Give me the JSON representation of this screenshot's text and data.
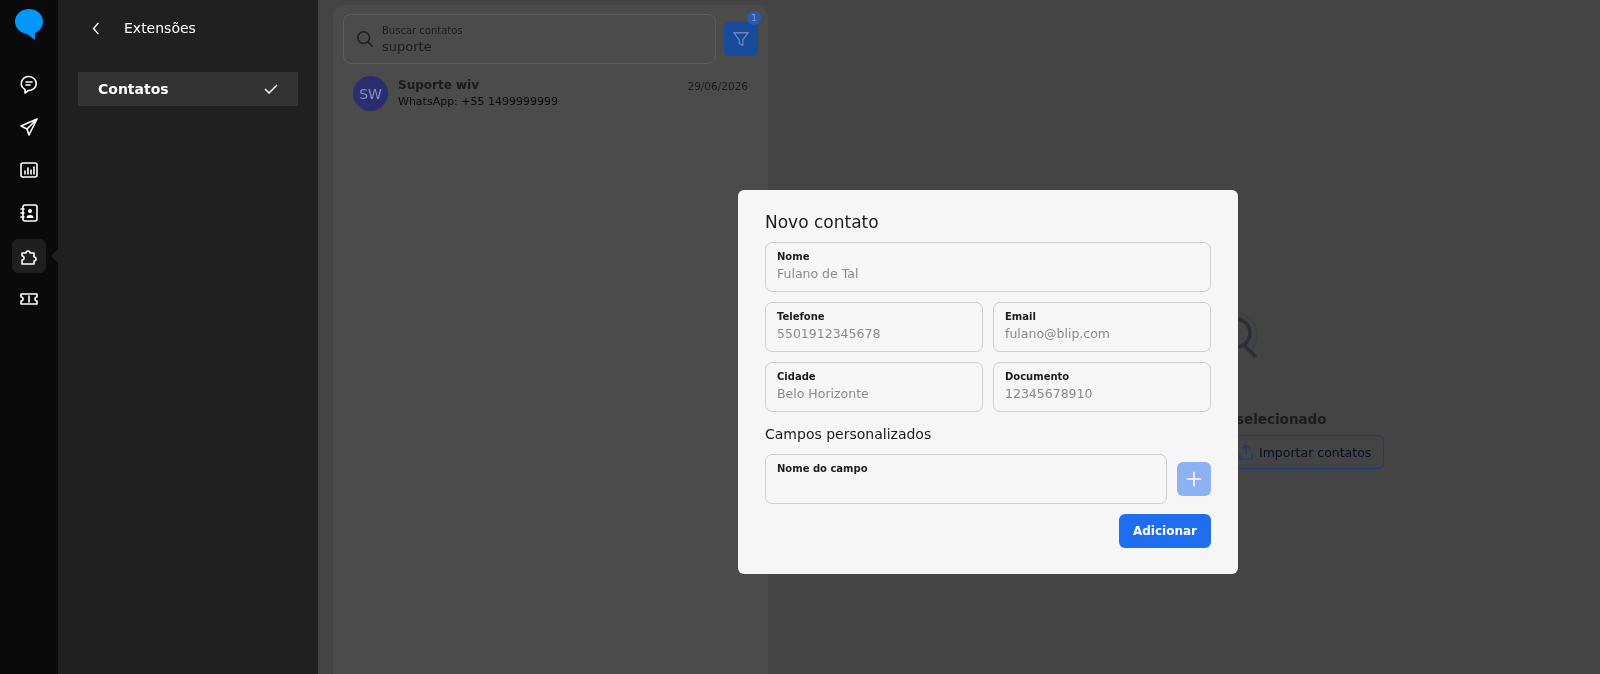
{
  "rail": {
    "items": [
      {
        "kind": "chat",
        "selected": false
      },
      {
        "kind": "send",
        "selected": false
      },
      {
        "kind": "chart",
        "selected": false
      },
      {
        "kind": "contacts",
        "selected": false
      },
      {
        "kind": "puzzle",
        "selected": true
      },
      {
        "kind": "ticket",
        "selected": false
      }
    ]
  },
  "sidebar": {
    "title": "Extensões",
    "items": [
      {
        "label": "Contatos",
        "selected": true
      }
    ]
  },
  "contact_list": {
    "search": {
      "label": "Buscar contatos",
      "value": "suporte"
    },
    "filter_badge": "1",
    "contacts": [
      {
        "initials": "SW",
        "name": "Suporte wiv",
        "detail": "WhatsApp: +55 1499999999",
        "date": "29/06/2026"
      }
    ]
  },
  "empty_state": {
    "message": "selecionado",
    "button": "Importar contatos"
  },
  "dialog": {
    "title": "Novo contato",
    "fields": [
      {
        "label": "Nome",
        "placeholder": "Fulano de Tal"
      },
      {
        "label": "Telefone",
        "placeholder": "5501912345678"
      },
      {
        "label": "Email",
        "placeholder": "fulano@blip.com"
      },
      {
        "label": "Cidade",
        "placeholder": "Belo Horizonte"
      },
      {
        "label": "Documento",
        "placeholder": "12345678910"
      }
    ],
    "custom_title": "Campos personalizados",
    "custom_field": {
      "label": "Nome do campo"
    },
    "add_field_disabled": true,
    "submit": "Adicionar"
  }
}
